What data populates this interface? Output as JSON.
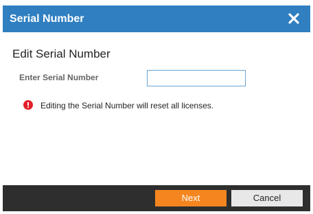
{
  "dialog": {
    "title": "Serial Number",
    "heading": "Edit Serial Number",
    "field_label": "Enter Serial Number",
    "serial_value": "",
    "serial_placeholder": "",
    "warning_text": "Editing the Serial Number will reset all licenses.",
    "close_icon": "close-icon",
    "warning_icon": "error-circle-icon",
    "buttons": {
      "next_label": "Next",
      "cancel_label": "Cancel"
    },
    "colors": {
      "titlebar": "#2f7fc1",
      "footer": "#2e2e2e",
      "primary_button": "#f5861f",
      "secondary_button": "#e8e8e8",
      "warning": "#e5202a"
    }
  }
}
